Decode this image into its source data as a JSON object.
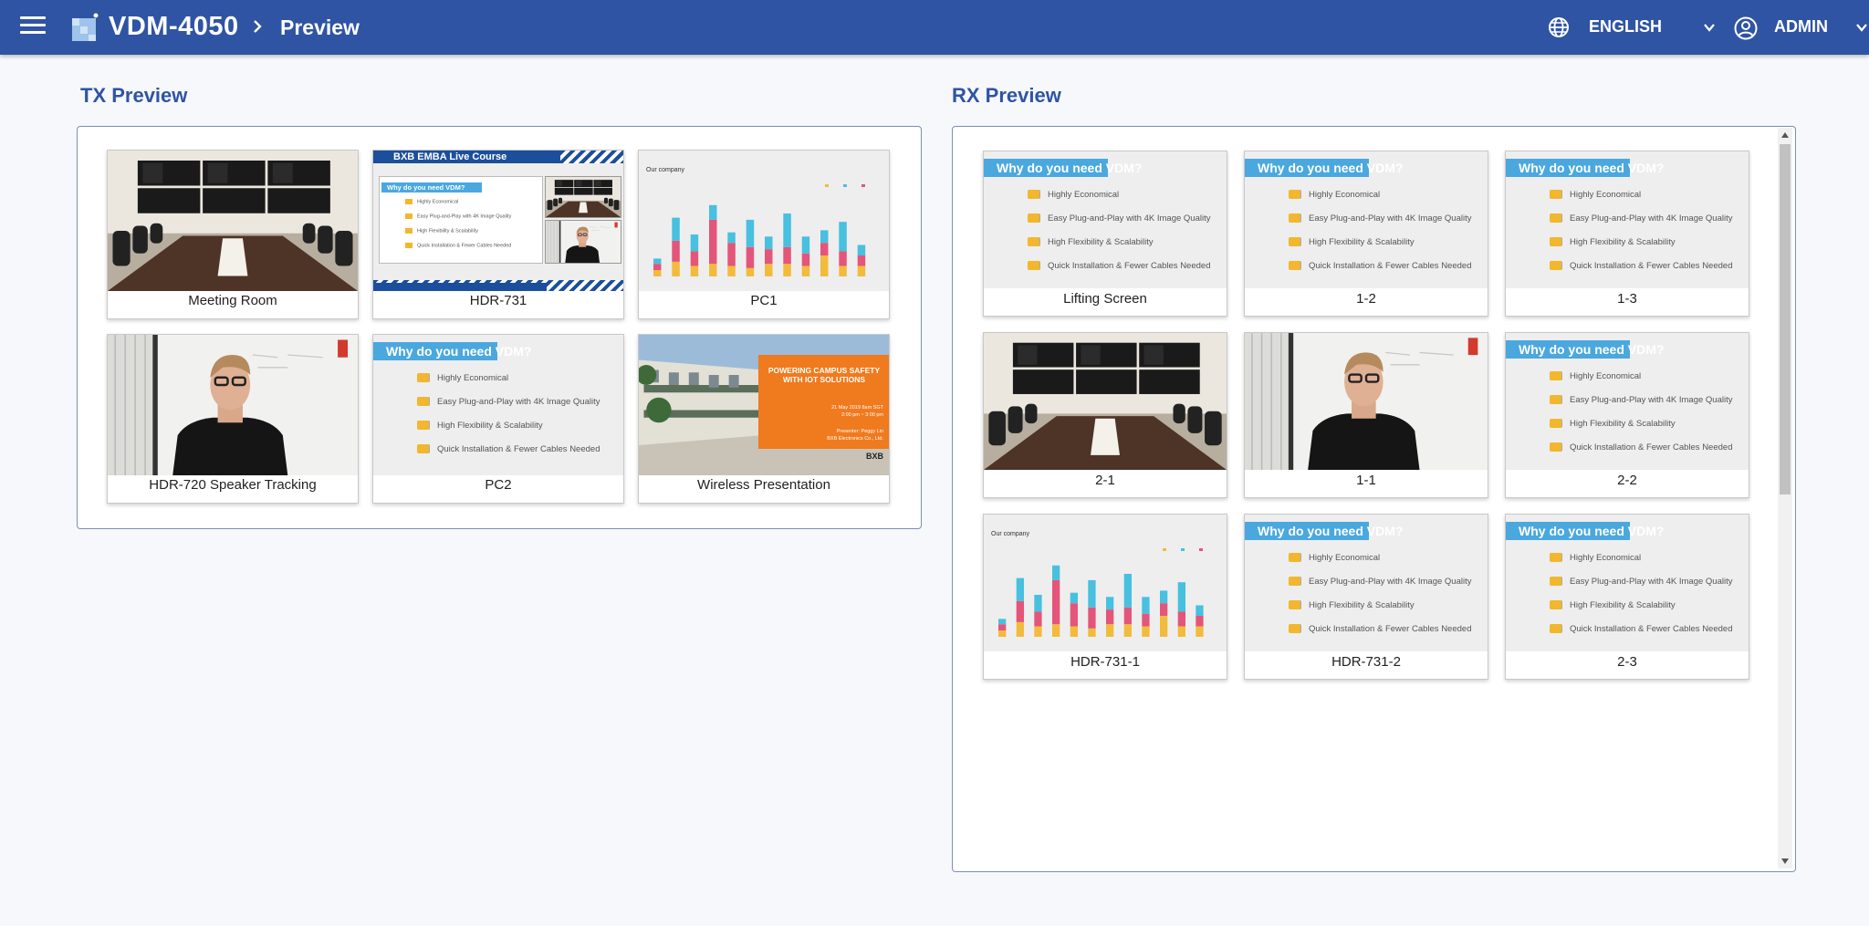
{
  "header": {
    "app_title": "VDM-4050",
    "breadcrumb": "Preview",
    "language": "ENGLISH",
    "user": "ADMIN",
    "bar_color": "#2f54a3"
  },
  "tx": {
    "title": "TX Preview",
    "tiles": [
      {
        "label": "Meeting Room",
        "thumb": "meeting-room"
      },
      {
        "label": "HDR-731",
        "thumb": "hdr-731-layout"
      },
      {
        "label": "PC1",
        "thumb": "bar-chart"
      },
      {
        "label": "HDR-720 Speaker Tracking",
        "thumb": "person"
      },
      {
        "label": "PC2",
        "thumb": "vdm-slide"
      },
      {
        "label": "Wireless Presentation",
        "thumb": "campus-slide"
      }
    ]
  },
  "rx": {
    "title": "RX Preview",
    "tiles": [
      {
        "label": "Lifting Screen",
        "thumb": "vdm-slide"
      },
      {
        "label": "1-2",
        "thumb": "vdm-slide"
      },
      {
        "label": "1-3",
        "thumb": "vdm-slide"
      },
      {
        "label": "2-1",
        "thumb": "meeting-room"
      },
      {
        "label": "1-1",
        "thumb": "person"
      },
      {
        "label": "2-2",
        "thumb": "vdm-slide"
      },
      {
        "label": "HDR-731-1",
        "thumb": "bar-chart"
      },
      {
        "label": "HDR-731-2",
        "thumb": "vdm-slide"
      },
      {
        "label": "2-3",
        "thumb": "vdm-slide"
      }
    ]
  },
  "slide": {
    "heading": "Why do you need VDM?",
    "points": [
      "Highly Economical",
      "Easy Plug-and-Play with 4K Image Quality",
      "High Flexibility & Scalability",
      "Quick Installation & Fewer Cables Needed"
    ]
  },
  "hdr731": {
    "banner": "BXB EMBA Live Course"
  },
  "chart_thumb": {
    "label": "Our company"
  },
  "campus": {
    "title": "POWERING CAMPUS SAFETY WITH IOT SOLUTIONS",
    "date": "21 May 2019 8am SGT",
    "time": "2:00 pm ~ 3:00 pm",
    "presenter": "Presenter: Peggy Lin",
    "company": "BXB Electronics Co., Ltd.",
    "logo": "BXB"
  }
}
